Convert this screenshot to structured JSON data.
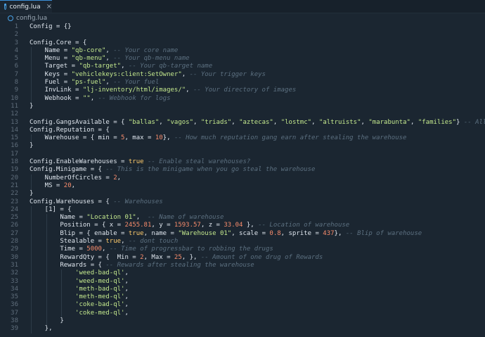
{
  "tab": {
    "label": "config.lua",
    "close": "×"
  },
  "breadcrumb": {
    "file": "config.lua"
  },
  "lines": [
    [
      [
        "t",
        "Config = {}"
      ]
    ],
    [],
    [
      [
        "t",
        "Config.Core = {"
      ]
    ],
    [
      [
        "t",
        "    Name = "
      ],
      [
        "s",
        "\"qb-core\""
      ],
      [
        "t",
        ", "
      ],
      [
        "c",
        "-- Your core name"
      ]
    ],
    [
      [
        "t",
        "    Menu = "
      ],
      [
        "s",
        "\"qb-menu\""
      ],
      [
        "t",
        ", "
      ],
      [
        "c",
        "-- Your qb-menu name"
      ]
    ],
    [
      [
        "t",
        "    Target = "
      ],
      [
        "s",
        "\"qb-target\""
      ],
      [
        "t",
        ", "
      ],
      [
        "c",
        "-- Your qb-target name"
      ]
    ],
    [
      [
        "t",
        "    Keys = "
      ],
      [
        "s",
        "\"vehiclekeys:client:SetOwner\""
      ],
      [
        "t",
        ", "
      ],
      [
        "c",
        "-- Your trigger keys"
      ]
    ],
    [
      [
        "t",
        "    Fuel = "
      ],
      [
        "s",
        "\"ps-fuel\""
      ],
      [
        "t",
        ", "
      ],
      [
        "c",
        "-- Your fuel"
      ]
    ],
    [
      [
        "t",
        "    InvLink = "
      ],
      [
        "s",
        "\"lj-inventory/html/images/\""
      ],
      [
        "t",
        ", "
      ],
      [
        "c",
        "-- Your directory of images"
      ]
    ],
    [
      [
        "t",
        "    Webhook = "
      ],
      [
        "s",
        "\"\""
      ],
      [
        "t",
        ", "
      ],
      [
        "c",
        "-- Webhook for logs"
      ]
    ],
    [
      [
        "t",
        "}"
      ]
    ],
    [],
    [
      [
        "t",
        "Config.GangsAvailable = { "
      ],
      [
        "s",
        "\"ballas\""
      ],
      [
        "t",
        ", "
      ],
      [
        "s",
        "\"vagos\""
      ],
      [
        "t",
        ", "
      ],
      [
        "s",
        "\"triads\""
      ],
      [
        "t",
        ", "
      ],
      [
        "s",
        "\"aztecas\""
      ],
      [
        "t",
        ", "
      ],
      [
        "s",
        "\"lostmc\""
      ],
      [
        "t",
        ", "
      ],
      [
        "s",
        "\"altruists\""
      ],
      [
        "t",
        ", "
      ],
      [
        "s",
        "\"marabunta\""
      ],
      [
        "t",
        ", "
      ],
      [
        "s",
        "\"families\""
      ],
      [
        "t",
        "} "
      ],
      [
        "c",
        "-- All Gangs"
      ]
    ],
    [
      [
        "t",
        "Config.Reputation = {"
      ]
    ],
    [
      [
        "t",
        "    Warehouse = { min = "
      ],
      [
        "n",
        "5"
      ],
      [
        "t",
        ", max = "
      ],
      [
        "n",
        "10"
      ],
      [
        "t",
        "}, "
      ],
      [
        "c",
        "-- How much reputation gang earn after stealing the warehouse"
      ]
    ],
    [
      [
        "t",
        "}"
      ]
    ],
    [],
    [
      [
        "t",
        "Config.EnableWarehouses = "
      ],
      [
        "b",
        "true"
      ],
      [
        "t",
        " "
      ],
      [
        "c",
        "-- Enable steal warehouses?"
      ]
    ],
    [
      [
        "t",
        "Config.Minigame = { "
      ],
      [
        "c",
        "-- This is the minigame when you go steal the warehouse"
      ]
    ],
    [
      [
        "t",
        "    NumberOfCircles = "
      ],
      [
        "n",
        "2"
      ],
      [
        "t",
        ","
      ]
    ],
    [
      [
        "t",
        "    MS = "
      ],
      [
        "n",
        "20"
      ],
      [
        "t",
        ","
      ]
    ],
    [
      [
        "t",
        "}"
      ]
    ],
    [
      [
        "t",
        "Config.Warehouses = { "
      ],
      [
        "c",
        "-- Warehouses"
      ]
    ],
    [
      [
        "t",
        "    [1] = {"
      ]
    ],
    [
      [
        "t",
        "        Name = "
      ],
      [
        "s",
        "\"Location 01\""
      ],
      [
        "t",
        ",  "
      ],
      [
        "c",
        "-- Name of warehouse"
      ]
    ],
    [
      [
        "t",
        "        Position = { x = "
      ],
      [
        "n",
        "2455.81"
      ],
      [
        "t",
        ", y = "
      ],
      [
        "n",
        "1593.57"
      ],
      [
        "t",
        ", z = "
      ],
      [
        "n",
        "33.04"
      ],
      [
        "t",
        " }, "
      ],
      [
        "c",
        "-- Location of warehouse"
      ]
    ],
    [
      [
        "t",
        "        Blip = { enable = "
      ],
      [
        "b",
        "true"
      ],
      [
        "t",
        ", name = "
      ],
      [
        "s",
        "\"Warehouse 01\""
      ],
      [
        "t",
        ", scale = "
      ],
      [
        "n",
        "0.8"
      ],
      [
        "t",
        ", sprite = "
      ],
      [
        "n",
        "437"
      ],
      [
        "t",
        "}, "
      ],
      [
        "c",
        "-- Blip of warehouse"
      ]
    ],
    [
      [
        "t",
        "        Stealable = "
      ],
      [
        "b",
        "true"
      ],
      [
        "t",
        ", "
      ],
      [
        "c",
        "-- dont touch"
      ]
    ],
    [
      [
        "t",
        "        Time = "
      ],
      [
        "n",
        "5000"
      ],
      [
        "t",
        ", "
      ],
      [
        "c",
        "-- Time of progressbar to robbing the drugs"
      ]
    ],
    [
      [
        "t",
        "        RewardQty = {  Min = "
      ],
      [
        "n",
        "2"
      ],
      [
        "t",
        ", Max = "
      ],
      [
        "n",
        "25"
      ],
      [
        "t",
        ", }, "
      ],
      [
        "c",
        "-- Amount of one drug of Rewards"
      ]
    ],
    [
      [
        "t",
        "        Rewards = { "
      ],
      [
        "c",
        "-- Rewards after stealing the warehouse"
      ]
    ],
    [
      [
        "t",
        "            "
      ],
      [
        "s",
        "'weed-bad-ql'"
      ],
      [
        "t",
        ","
      ]
    ],
    [
      [
        "t",
        "            "
      ],
      [
        "s",
        "'weed-med-ql'"
      ],
      [
        "t",
        ","
      ]
    ],
    [
      [
        "t",
        "            "
      ],
      [
        "s",
        "'meth-bad-ql'"
      ],
      [
        "t",
        ","
      ]
    ],
    [
      [
        "t",
        "            "
      ],
      [
        "s",
        "'meth-med-ql'"
      ],
      [
        "t",
        ","
      ]
    ],
    [
      [
        "t",
        "            "
      ],
      [
        "s",
        "'coke-bad-ql'"
      ],
      [
        "t",
        ","
      ]
    ],
    [
      [
        "t",
        "            "
      ],
      [
        "s",
        "'coke-med-ql'"
      ],
      [
        "t",
        ","
      ]
    ],
    [
      [
        "t",
        "        }"
      ]
    ],
    [
      [
        "t",
        "    },"
      ]
    ]
  ],
  "colors": {
    "background": "#1b2631",
    "string": "#c3e88d",
    "number": "#f78c6c",
    "boolean": "#ffcb6b",
    "comment": "#5c7080",
    "text": "#dfe6ee",
    "accent": "#3b8fd8"
  }
}
